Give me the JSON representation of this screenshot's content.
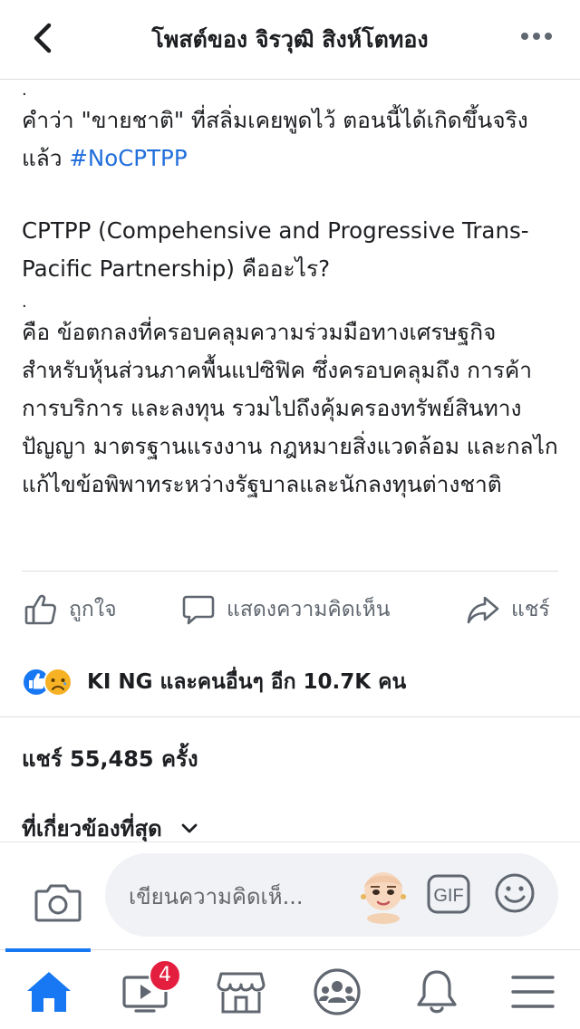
{
  "header": {
    "title": "โพสต์ของ จิรวุฒิ สิงห์โตทอง",
    "back_icon": "chevron-left-icon",
    "more_icon": "more-horizontal-icon"
  },
  "post": {
    "dot_1": ".",
    "para_1": "คำว่า \"ขายชาติ\" ที่สลิ่มเคยพูดไว้ ตอนนี้ได้เกิดขึ้นจริงแล้ว",
    "hashtag": "#NoCPTPP",
    "para_2": "CPTPP (Compehensive and Progressive Trans-Pacific Partnership) คืออะไร?",
    "dot_2": ".",
    "para_3": "คือ ข้อตกลงที่ครอบคลุมความร่วมมือทางเศรษฐกิจสำหรับหุ้นส่วนภาคพื้นแปซิฟิค ซึ่งครอบคลุมถึง การค้า การบริการ และลงทุน รวมไปถึงคุ้มครองทรัพย์สินทางปัญญา มาตรฐานแรงงาน กฎหมายสิ่งแวดล้อม และกลไกแก้ไขข้อพิพาทระหว่างรัฐบาลและนักลงทุนต่างชาติ",
    "hashtag_color": "#216fdb"
  },
  "actions": {
    "like": "ถูกใจ",
    "comment": "แสดงความคิดเห็น",
    "share": "แชร์"
  },
  "reactions": {
    "text": "KI NG และคนอื่นๆ อีก 10.7K คน",
    "icons": [
      "like-reaction-icon",
      "sad-reaction-icon"
    ]
  },
  "stats": {
    "shares": "แชร์ 55,485 ครั้ง",
    "sort_label": "ที่เกี่ยวข้องที่สุด"
  },
  "composer": {
    "placeholder": "เขียนความคิดเห็...",
    "gif_label": "GIF"
  },
  "tabbar": {
    "items": [
      "home-icon",
      "watch-icon",
      "marketplace-icon",
      "groups-icon",
      "notifications-icon",
      "menu-icon"
    ],
    "watch_badge": "4",
    "accent": "#1877f2",
    "badge_color": "#e41e3f"
  }
}
